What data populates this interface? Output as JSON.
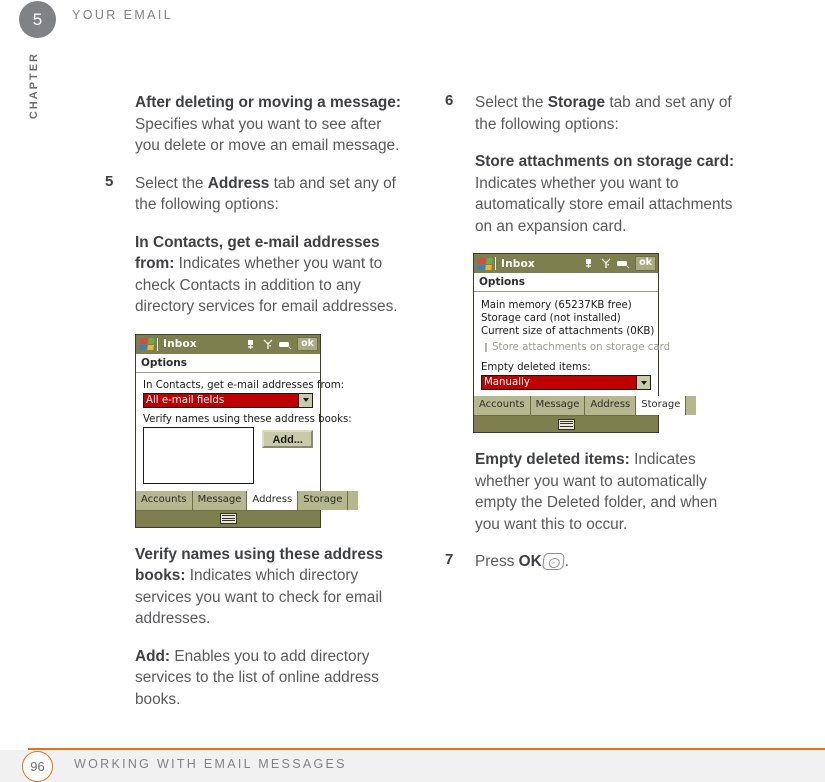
{
  "header": {
    "chapter_number": "5",
    "chapter_word": "CHAPTER",
    "running_head": "YOUR EMAIL"
  },
  "footer": {
    "page_number": "96",
    "section_title": "WORKING WITH EMAIL MESSAGES",
    "rule_color": "#e8701a"
  },
  "left_column": {
    "para_after_deleting": {
      "term": "After deleting or moving a message:",
      "text": " Specifies what you want to see after you delete or move an email message."
    },
    "step5": {
      "number": "5",
      "text_before": "Select the ",
      "bold": "Address",
      "text_after": " tab and set any of the following options:"
    },
    "para_contacts": {
      "term": "In Contacts, get e-mail addresses from:",
      "text": " Indicates whether you want to check Contacts in addition to any directory services for email addresses."
    },
    "para_verify": {
      "term": "Verify names using these address books:",
      "text": " Indicates which directory services you want to check for email addresses."
    },
    "para_add": {
      "term": "Add:",
      "text": " Enables you to add directory services to the list of online address books."
    }
  },
  "right_column": {
    "step6": {
      "number": "6",
      "text_before": "Select the ",
      "bold": "Storage",
      "text_after": " tab and set any of the following options:"
    },
    "para_store_attachments": {
      "term": "Store attachments on storage card:",
      "text": " Indicates whether you want to automatically store email attachments on an expansion card."
    },
    "para_empty_deleted": {
      "term": "Empty deleted items:",
      "text": " Indicates whether you want to automatically empty the Deleted folder, and when you want this to occur."
    },
    "step7": {
      "number": "7",
      "text_before": "Press ",
      "bold": "OK",
      "text_after": "."
    }
  },
  "device_address": {
    "title": "Inbox",
    "ok_label": "ok",
    "subtitle": "Options",
    "field_label": "In Contacts, get e-mail addresses from:",
    "field_value": "All e-mail fields",
    "list_label": "Verify names using these address books:",
    "add_button": "Add...",
    "tabs": [
      {
        "label": "Accounts",
        "active": false
      },
      {
        "label": "Message",
        "active": false
      },
      {
        "label": "Address",
        "active": true
      },
      {
        "label": "Storage",
        "active": false
      }
    ],
    "icons": {
      "volume": "volume-icon",
      "signal": "signal-icon",
      "connectivity": "connectivity-icon",
      "keyboard": "keyboard-icon",
      "logo": "windows-logo-icon"
    },
    "colors": {
      "title_bar": "#7d7f4e",
      "tab_bar": "#b5b78e",
      "highlight": "#c00000"
    }
  },
  "device_storage": {
    "title": "Inbox",
    "ok_label": "ok",
    "subtitle": "Options",
    "info_lines": [
      "Main memory (65237KB free)",
      "Storage card (not installed)",
      "Current size of attachments (0KB)"
    ],
    "checkbox_label": "Store attachments on storage card",
    "checkbox_checked": false,
    "field_label": "Empty deleted items:",
    "field_value": "Manually",
    "tabs": [
      {
        "label": "Accounts",
        "active": false
      },
      {
        "label": "Message",
        "active": false
      },
      {
        "label": "Address",
        "active": false
      },
      {
        "label": "Storage",
        "active": true
      }
    ],
    "icons": {
      "volume": "volume-icon",
      "signal": "signal-icon",
      "connectivity": "connectivity-icon",
      "keyboard": "keyboard-icon",
      "logo": "windows-logo-icon"
    },
    "colors": {
      "title_bar": "#7d7f4e",
      "tab_bar": "#b5b78e",
      "highlight": "#c00000"
    }
  }
}
